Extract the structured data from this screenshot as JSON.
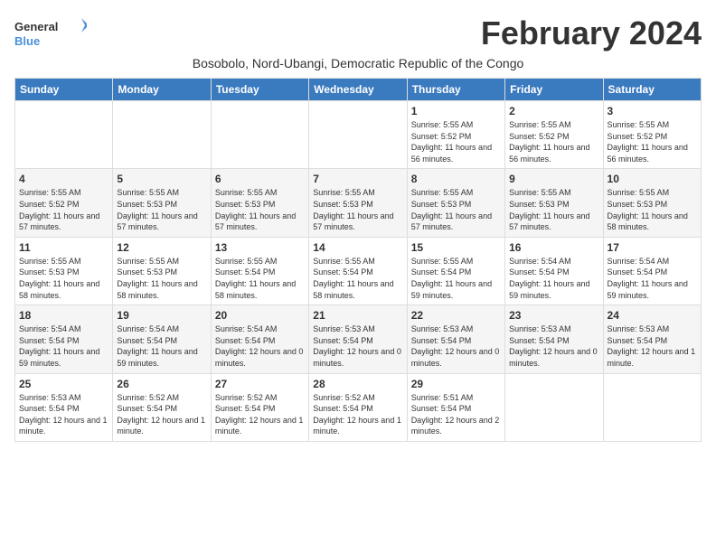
{
  "logo": {
    "line1": "General",
    "line2": "Blue"
  },
  "title": "February 2024",
  "subtitle": "Bosobolo, Nord-Ubangi, Democratic Republic of the Congo",
  "days_of_week": [
    "Sunday",
    "Monday",
    "Tuesday",
    "Wednesday",
    "Thursday",
    "Friday",
    "Saturday"
  ],
  "weeks": [
    [
      {
        "day": "",
        "info": ""
      },
      {
        "day": "",
        "info": ""
      },
      {
        "day": "",
        "info": ""
      },
      {
        "day": "",
        "info": ""
      },
      {
        "day": "1",
        "info": "Sunrise: 5:55 AM\nSunset: 5:52 PM\nDaylight: 11 hours and 56 minutes."
      },
      {
        "day": "2",
        "info": "Sunrise: 5:55 AM\nSunset: 5:52 PM\nDaylight: 11 hours and 56 minutes."
      },
      {
        "day": "3",
        "info": "Sunrise: 5:55 AM\nSunset: 5:52 PM\nDaylight: 11 hours and 56 minutes."
      }
    ],
    [
      {
        "day": "4",
        "info": "Sunrise: 5:55 AM\nSunset: 5:52 PM\nDaylight: 11 hours and 57 minutes."
      },
      {
        "day": "5",
        "info": "Sunrise: 5:55 AM\nSunset: 5:53 PM\nDaylight: 11 hours and 57 minutes."
      },
      {
        "day": "6",
        "info": "Sunrise: 5:55 AM\nSunset: 5:53 PM\nDaylight: 11 hours and 57 minutes."
      },
      {
        "day": "7",
        "info": "Sunrise: 5:55 AM\nSunset: 5:53 PM\nDaylight: 11 hours and 57 minutes."
      },
      {
        "day": "8",
        "info": "Sunrise: 5:55 AM\nSunset: 5:53 PM\nDaylight: 11 hours and 57 minutes."
      },
      {
        "day": "9",
        "info": "Sunrise: 5:55 AM\nSunset: 5:53 PM\nDaylight: 11 hours and 57 minutes."
      },
      {
        "day": "10",
        "info": "Sunrise: 5:55 AM\nSunset: 5:53 PM\nDaylight: 11 hours and 58 minutes."
      }
    ],
    [
      {
        "day": "11",
        "info": "Sunrise: 5:55 AM\nSunset: 5:53 PM\nDaylight: 11 hours and 58 minutes."
      },
      {
        "day": "12",
        "info": "Sunrise: 5:55 AM\nSunset: 5:53 PM\nDaylight: 11 hours and 58 minutes."
      },
      {
        "day": "13",
        "info": "Sunrise: 5:55 AM\nSunset: 5:54 PM\nDaylight: 11 hours and 58 minutes."
      },
      {
        "day": "14",
        "info": "Sunrise: 5:55 AM\nSunset: 5:54 PM\nDaylight: 11 hours and 58 minutes."
      },
      {
        "day": "15",
        "info": "Sunrise: 5:55 AM\nSunset: 5:54 PM\nDaylight: 11 hours and 59 minutes."
      },
      {
        "day": "16",
        "info": "Sunrise: 5:54 AM\nSunset: 5:54 PM\nDaylight: 11 hours and 59 minutes."
      },
      {
        "day": "17",
        "info": "Sunrise: 5:54 AM\nSunset: 5:54 PM\nDaylight: 11 hours and 59 minutes."
      }
    ],
    [
      {
        "day": "18",
        "info": "Sunrise: 5:54 AM\nSunset: 5:54 PM\nDaylight: 11 hours and 59 minutes."
      },
      {
        "day": "19",
        "info": "Sunrise: 5:54 AM\nSunset: 5:54 PM\nDaylight: 11 hours and 59 minutes."
      },
      {
        "day": "20",
        "info": "Sunrise: 5:54 AM\nSunset: 5:54 PM\nDaylight: 12 hours and 0 minutes."
      },
      {
        "day": "21",
        "info": "Sunrise: 5:53 AM\nSunset: 5:54 PM\nDaylight: 12 hours and 0 minutes."
      },
      {
        "day": "22",
        "info": "Sunrise: 5:53 AM\nSunset: 5:54 PM\nDaylight: 12 hours and 0 minutes."
      },
      {
        "day": "23",
        "info": "Sunrise: 5:53 AM\nSunset: 5:54 PM\nDaylight: 12 hours and 0 minutes."
      },
      {
        "day": "24",
        "info": "Sunrise: 5:53 AM\nSunset: 5:54 PM\nDaylight: 12 hours and 1 minute."
      }
    ],
    [
      {
        "day": "25",
        "info": "Sunrise: 5:53 AM\nSunset: 5:54 PM\nDaylight: 12 hours and 1 minute."
      },
      {
        "day": "26",
        "info": "Sunrise: 5:52 AM\nSunset: 5:54 PM\nDaylight: 12 hours and 1 minute."
      },
      {
        "day": "27",
        "info": "Sunrise: 5:52 AM\nSunset: 5:54 PM\nDaylight: 12 hours and 1 minute."
      },
      {
        "day": "28",
        "info": "Sunrise: 5:52 AM\nSunset: 5:54 PM\nDaylight: 12 hours and 1 minute."
      },
      {
        "day": "29",
        "info": "Sunrise: 5:51 AM\nSunset: 5:54 PM\nDaylight: 12 hours and 2 minutes."
      },
      {
        "day": "",
        "info": ""
      },
      {
        "day": "",
        "info": ""
      }
    ]
  ]
}
